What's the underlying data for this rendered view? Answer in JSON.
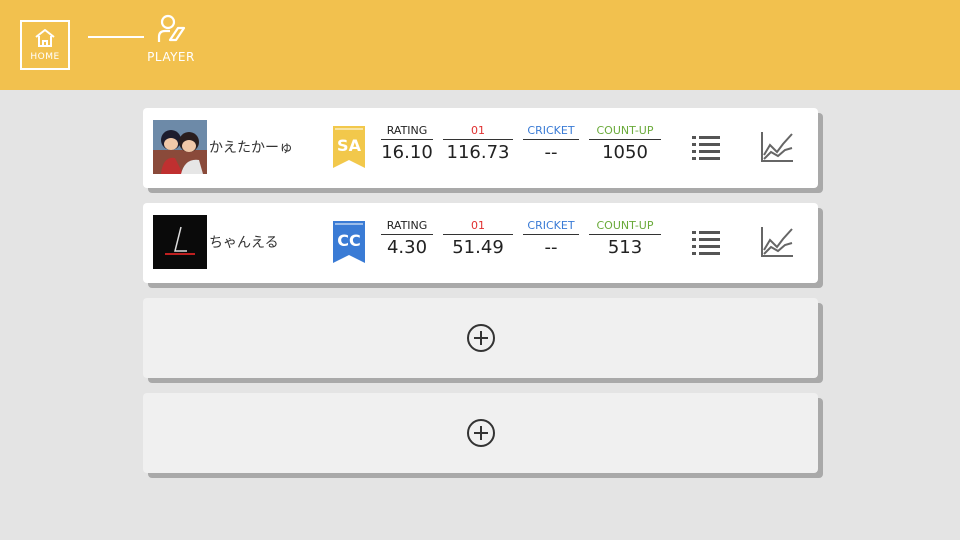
{
  "header": {
    "home_label": "HOME",
    "player_label": "PLAYER"
  },
  "colors": {
    "header_bg": "#f2c14e",
    "rank_sa": "#f2c84b",
    "rank_cc": "#3a7bd5",
    "label_rating": "#222222",
    "label_01": "#e03030",
    "label_cricket": "#3a7bd5",
    "label_countup": "#6aaa3a"
  },
  "players": [
    {
      "name": "かえたかーゅ",
      "rank": "SA",
      "rating_label": "RATING",
      "rating": "16.10",
      "zero_one_label": "01",
      "zero_one": "116.73",
      "cricket_label": "CRICKET",
      "cricket": "--",
      "countup_label": "COUNT-UP",
      "countup": "1050"
    },
    {
      "name": "ちゃんえる",
      "rank": "CC",
      "rating_label": "RATING",
      "rating": "4.30",
      "zero_one_label": "01",
      "zero_one": "51.49",
      "cricket_label": "CRICKET",
      "cricket": "--",
      "countup_label": "COUNT-UP",
      "countup": "513"
    }
  ],
  "icons": [
    "home-icon",
    "player-icon",
    "list-icon",
    "chart-icon",
    "plus-circle-icon"
  ]
}
